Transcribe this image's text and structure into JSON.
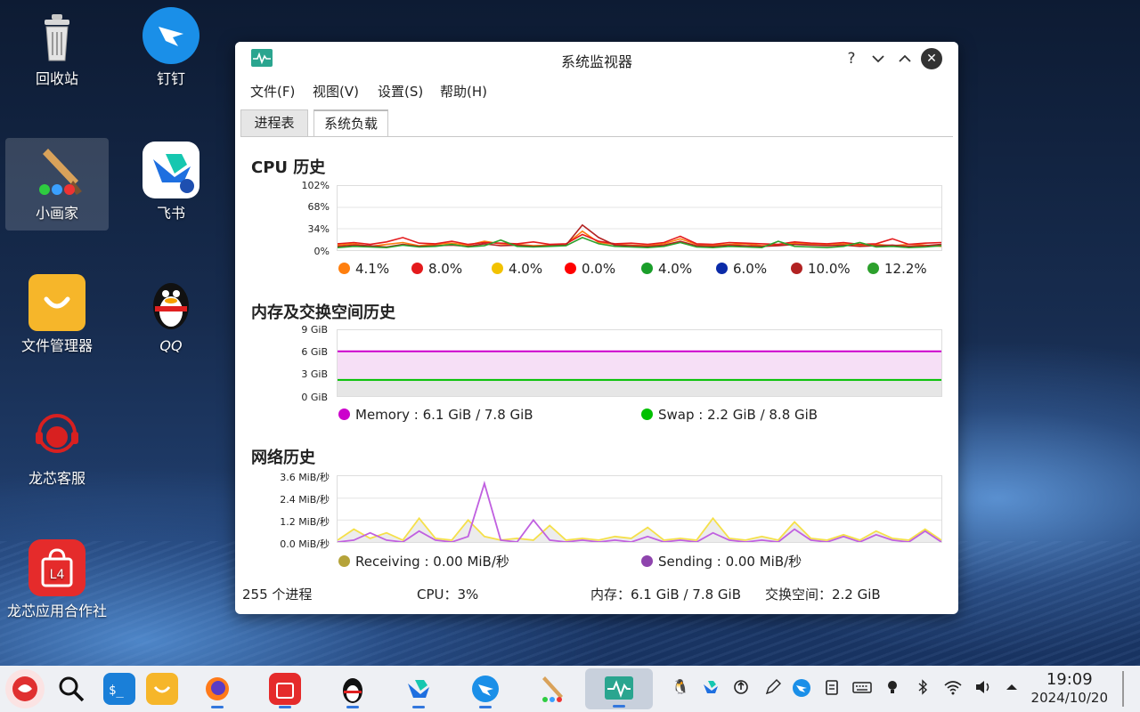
{
  "desktop": {
    "icons": [
      {
        "label": "回收站"
      },
      {
        "label": "钉钉"
      },
      {
        "label": "小画家"
      },
      {
        "label": "飞书"
      },
      {
        "label": "文件管理器"
      },
      {
        "label": "QQ"
      },
      {
        "label": "龙芯客服"
      },
      {
        "label": "龙芯应用合作社"
      }
    ]
  },
  "window": {
    "title": "系统监视器",
    "controls": {
      "help": "?",
      "minimize": "⌄",
      "maximize": "⌃",
      "close": "✕"
    },
    "menu": [
      "文件(F)",
      "视图(V)",
      "设置(S)",
      "帮助(H)"
    ],
    "tabs": [
      {
        "label": "进程表",
        "active": false
      },
      {
        "label": "系统负载",
        "active": true
      }
    ],
    "cpu": {
      "title": "CPU 历史",
      "yticks": [
        "102%",
        "68%",
        "34%",
        "0%"
      ],
      "legend": [
        {
          "value": "4.1%",
          "color": "#ff7f0e"
        },
        {
          "value": "8.0%",
          "color": "#e41a1c"
        },
        {
          "value": "4.0%",
          "color": "#f2c200"
        },
        {
          "value": "0.0%",
          "color": "#ff0000"
        },
        {
          "value": "4.0%",
          "color": "#1a9e2a"
        },
        {
          "value": "6.0%",
          "color": "#0a2aa8"
        },
        {
          "value": "10.0%",
          "color": "#b22222"
        },
        {
          "value": "12.2%",
          "color": "#2ca02c"
        }
      ]
    },
    "memory": {
      "title": "内存及交换空间历史",
      "yticks": [
        "9 GiB",
        "6 GiB",
        "3 GiB",
        "0 GiB"
      ],
      "legend": [
        {
          "label": "Memory : 6.1 GiB / 7.8 GiB",
          "color": "#cc00cc"
        },
        {
          "label": "Swap : 2.2 GiB / 8.8 GiB",
          "color": "#00c000"
        }
      ]
    },
    "network": {
      "title": "网络历史",
      "yticks": [
        "3.6 MiB/秒",
        "2.4 MiB/秒",
        "1.2 MiB/秒",
        "0.0 MiB/秒"
      ],
      "legend": [
        {
          "label": "Receiving : 0.00 MiB/秒",
          "color": "#b5a33a"
        },
        {
          "label": "Sending : 0.00 MiB/秒",
          "color": "#8e44ad"
        }
      ]
    },
    "status": {
      "processes": "255 个进程",
      "cpu": "CPU：3%",
      "memory": "内存：6.1 GiB / 7.8 GiB",
      "swap": "交换空间：2.2 GiB"
    }
  },
  "chart_data": [
    {
      "type": "line",
      "title": "CPU 历史",
      "ylim": [
        0,
        102
      ],
      "series": [
        {
          "name": "4.1%",
          "values": [
            8,
            10,
            6,
            9,
            12,
            7,
            9,
            11,
            8,
            14,
            10,
            9,
            7,
            8,
            9,
            30,
            12,
            9,
            8,
            7,
            10,
            18,
            9,
            8,
            9,
            10,
            7,
            8,
            11,
            9,
            8,
            10,
            8,
            9,
            7,
            9,
            8,
            6
          ]
        },
        {
          "name": "8.0%",
          "values": [
            10,
            12,
            9,
            13,
            20,
            11,
            10,
            14,
            9,
            12,
            11,
            10,
            13,
            9,
            10,
            25,
            14,
            10,
            11,
            9,
            12,
            22,
            10,
            9,
            12,
            11,
            10,
            9,
            13,
            11,
            10,
            12,
            9,
            10,
            18,
            9,
            11,
            12
          ]
        },
        {
          "name": "10.0%",
          "values": [
            6,
            8,
            7,
            5,
            9,
            6,
            7,
            8,
            6,
            10,
            7,
            8,
            6,
            7,
            8,
            40,
            20,
            8,
            7,
            6,
            8,
            14,
            7,
            6,
            8,
            7,
            6,
            7,
            9,
            8,
            7,
            8,
            6,
            7,
            8,
            6,
            7,
            9
          ]
        },
        {
          "name": "12.2%",
          "values": [
            4,
            6,
            5,
            4,
            8,
            5,
            6,
            9,
            5,
            7,
            16,
            6,
            5,
            6,
            7,
            20,
            10,
            6,
            5,
            4,
            6,
            12,
            5,
            4,
            6,
            5,
            4,
            14,
            6,
            5,
            4,
            6,
            12,
            5,
            6,
            4,
            5,
            7
          ]
        }
      ]
    },
    {
      "type": "area",
      "title": "内存及交换空间历史",
      "ylim": [
        0,
        9
      ],
      "series": [
        {
          "name": "Memory : 6.1 GiB / 7.8 GiB",
          "values": [
            6.1,
            6.1,
            6.1,
            6.1,
            6.1,
            6.1,
            6.1,
            6.1,
            6.1,
            6.1
          ]
        },
        {
          "name": "Swap : 2.2 GiB / 8.8 GiB",
          "values": [
            2.2,
            2.2,
            2.2,
            2.2,
            2.2,
            2.2,
            2.2,
            2.2,
            2.2,
            2.2
          ]
        }
      ]
    },
    {
      "type": "line",
      "title": "网络历史",
      "ylim": [
        0,
        3.6
      ],
      "series": [
        {
          "name": "Receiving : 0.00 MiB/秒",
          "values": [
            0.1,
            0.7,
            0.2,
            0.5,
            0.1,
            1.3,
            0.2,
            0.1,
            1.2,
            0.3,
            0.1,
            0.2,
            0.1,
            0.9,
            0.1,
            0.2,
            0.1,
            0.3,
            0.2,
            0.8,
            0.1,
            0.2,
            0.1,
            1.3,
            0.2,
            0.1,
            0.3,
            0.1,
            1.1,
            0.2,
            0.1,
            0.4,
            0.1,
            0.6,
            0.2,
            0.1,
            0.7,
            0.1
          ]
        },
        {
          "name": "Sending : 0.00 MiB/秒",
          "values": [
            0.0,
            0.1,
            0.5,
            0.1,
            0.0,
            0.6,
            0.1,
            0.0,
            0.3,
            3.2,
            0.1,
            0.0,
            1.2,
            0.1,
            0.0,
            0.1,
            0.0,
            0.1,
            0.0,
            0.3,
            0.0,
            0.1,
            0.0,
            0.5,
            0.1,
            0.0,
            0.1,
            0.0,
            0.7,
            0.1,
            0.0,
            0.3,
            0.0,
            0.4,
            0.1,
            0.0,
            0.6,
            0.0
          ]
        }
      ]
    }
  ],
  "taskbar": {
    "apps": [
      "launcher-icon",
      "search-icon",
      "terminal-icon",
      "file-manager-icon",
      "firefox-icon",
      "app-store-icon",
      "qq-icon",
      "feishu-icon",
      "dingtalk-icon",
      "paint-icon",
      "system-monitor-icon"
    ],
    "tray": [
      "qq-tray-icon",
      "feishu-tray-icon",
      "update-icon",
      "pen-icon",
      "dingtalk-tray-icon",
      "clipboard-icon",
      "keyboard-icon",
      "notification-icon",
      "bluetooth-icon",
      "wifi-icon",
      "volume-icon",
      "tray-expand-icon"
    ],
    "time": "19:09",
    "date": "2024/10/20"
  }
}
